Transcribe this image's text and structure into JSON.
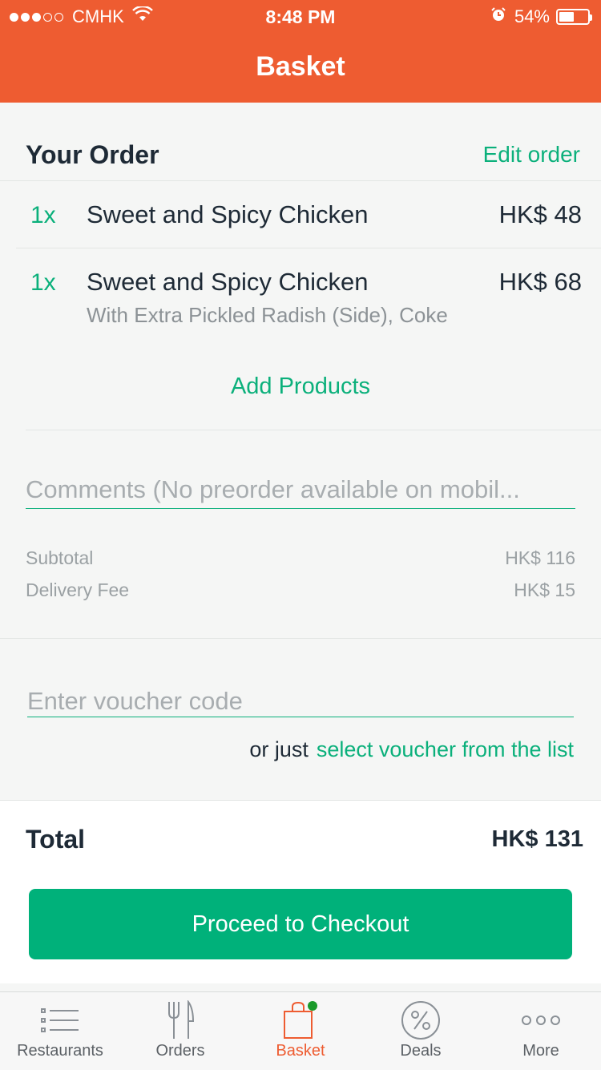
{
  "status_bar": {
    "carrier": "CMHK",
    "time": "8:48 PM",
    "battery": "54%",
    "battery_level": 0.54,
    "signal_bars_filled": 3,
    "signal_bars_total": 5
  },
  "header": {
    "title": "Basket"
  },
  "order": {
    "heading": "Your Order",
    "edit_label": "Edit order",
    "items": [
      {
        "qty": "1x",
        "name": "Sweet and Spicy Chicken",
        "price": "HK$ 48",
        "options": ""
      },
      {
        "qty": "1x",
        "name": "Sweet and Spicy Chicken",
        "price": "HK$ 68",
        "options": "With Extra Pickled Radish (Side), Coke"
      }
    ],
    "add_products_label": "Add Products"
  },
  "comments": {
    "placeholder": "Comments (No preorder available on mobil..."
  },
  "summary": {
    "subtotal_label": "Subtotal",
    "subtotal_value": "HK$ 116",
    "delivery_label": "Delivery Fee",
    "delivery_value": "HK$ 15"
  },
  "voucher": {
    "placeholder": "Enter voucher code",
    "or_just": "or just",
    "select_link": "select voucher from the list"
  },
  "total": {
    "label": "Total",
    "value": "HK$ 131",
    "checkout_label": "Proceed to Checkout"
  },
  "tabs": [
    {
      "label": "Restaurants",
      "icon": "list-icon",
      "active": false
    },
    {
      "label": "Orders",
      "icon": "fork-knife-icon",
      "active": false
    },
    {
      "label": "Basket",
      "icon": "shopping-bag-icon",
      "active": true
    },
    {
      "label": "Deals",
      "icon": "percent-icon",
      "active": false
    },
    {
      "label": "More",
      "icon": "more-dots-icon",
      "active": false
    }
  ],
  "colors": {
    "brand_orange": "#ee5c31",
    "accent_green": "#0bb07b",
    "checkout_green": "#00b17a",
    "badge_green": "#1a9a2a"
  }
}
